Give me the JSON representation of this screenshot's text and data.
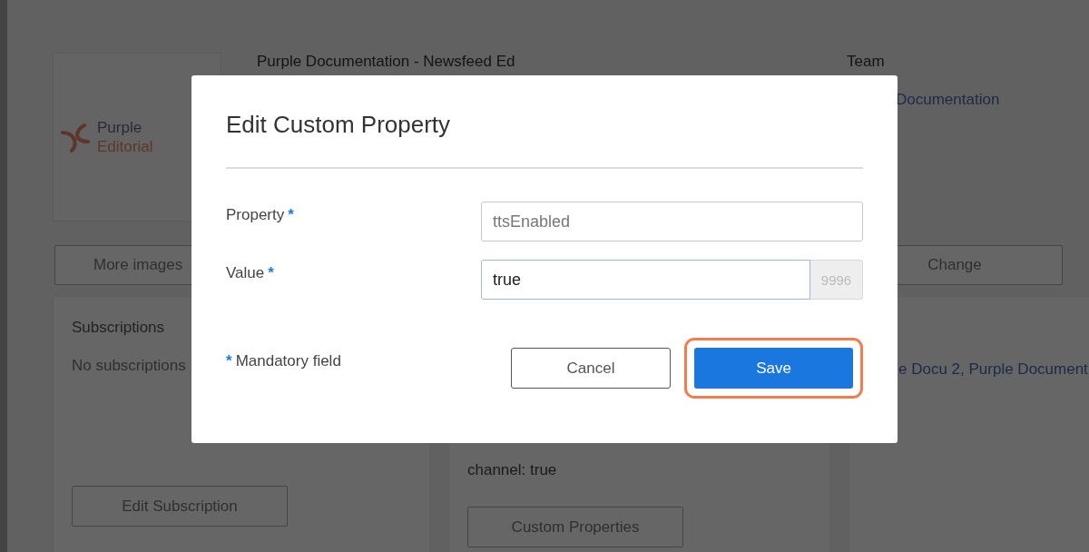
{
  "background": {
    "logo": {
      "line1": "Purple",
      "line2": "Editorial"
    },
    "title": "Purple Documentation - Newsfeed Ed",
    "team_label": "Team",
    "team_link": "Documentation",
    "more_images_button": "More images",
    "change_button": "Change",
    "subscriptions_title": "Subscriptions",
    "subscriptions_empty": "No subscriptions",
    "subscription_links": "e Docu 2, Purple Document",
    "custom_properties_text": "channel: true",
    "edit_subscription_button": "Edit Subscription",
    "custom_properties_button": "Custom Properties"
  },
  "dialog": {
    "title": "Edit Custom Property",
    "fields": [
      {
        "label": "Property",
        "required_mark": "*",
        "value": "ttsEnabled",
        "disabled": true,
        "focused": false
      },
      {
        "label": "Value",
        "required_mark": "*",
        "value": "true",
        "disabled": false,
        "focused": true,
        "counter": "9996"
      }
    ],
    "mandatory_note": {
      "mark": "*",
      "text": "Mandatory field"
    },
    "buttons": [
      {
        "label": "Cancel",
        "kind": "secondary",
        "highlighted": false
      },
      {
        "label": "Save",
        "kind": "primary",
        "highlighted": true
      }
    ]
  }
}
